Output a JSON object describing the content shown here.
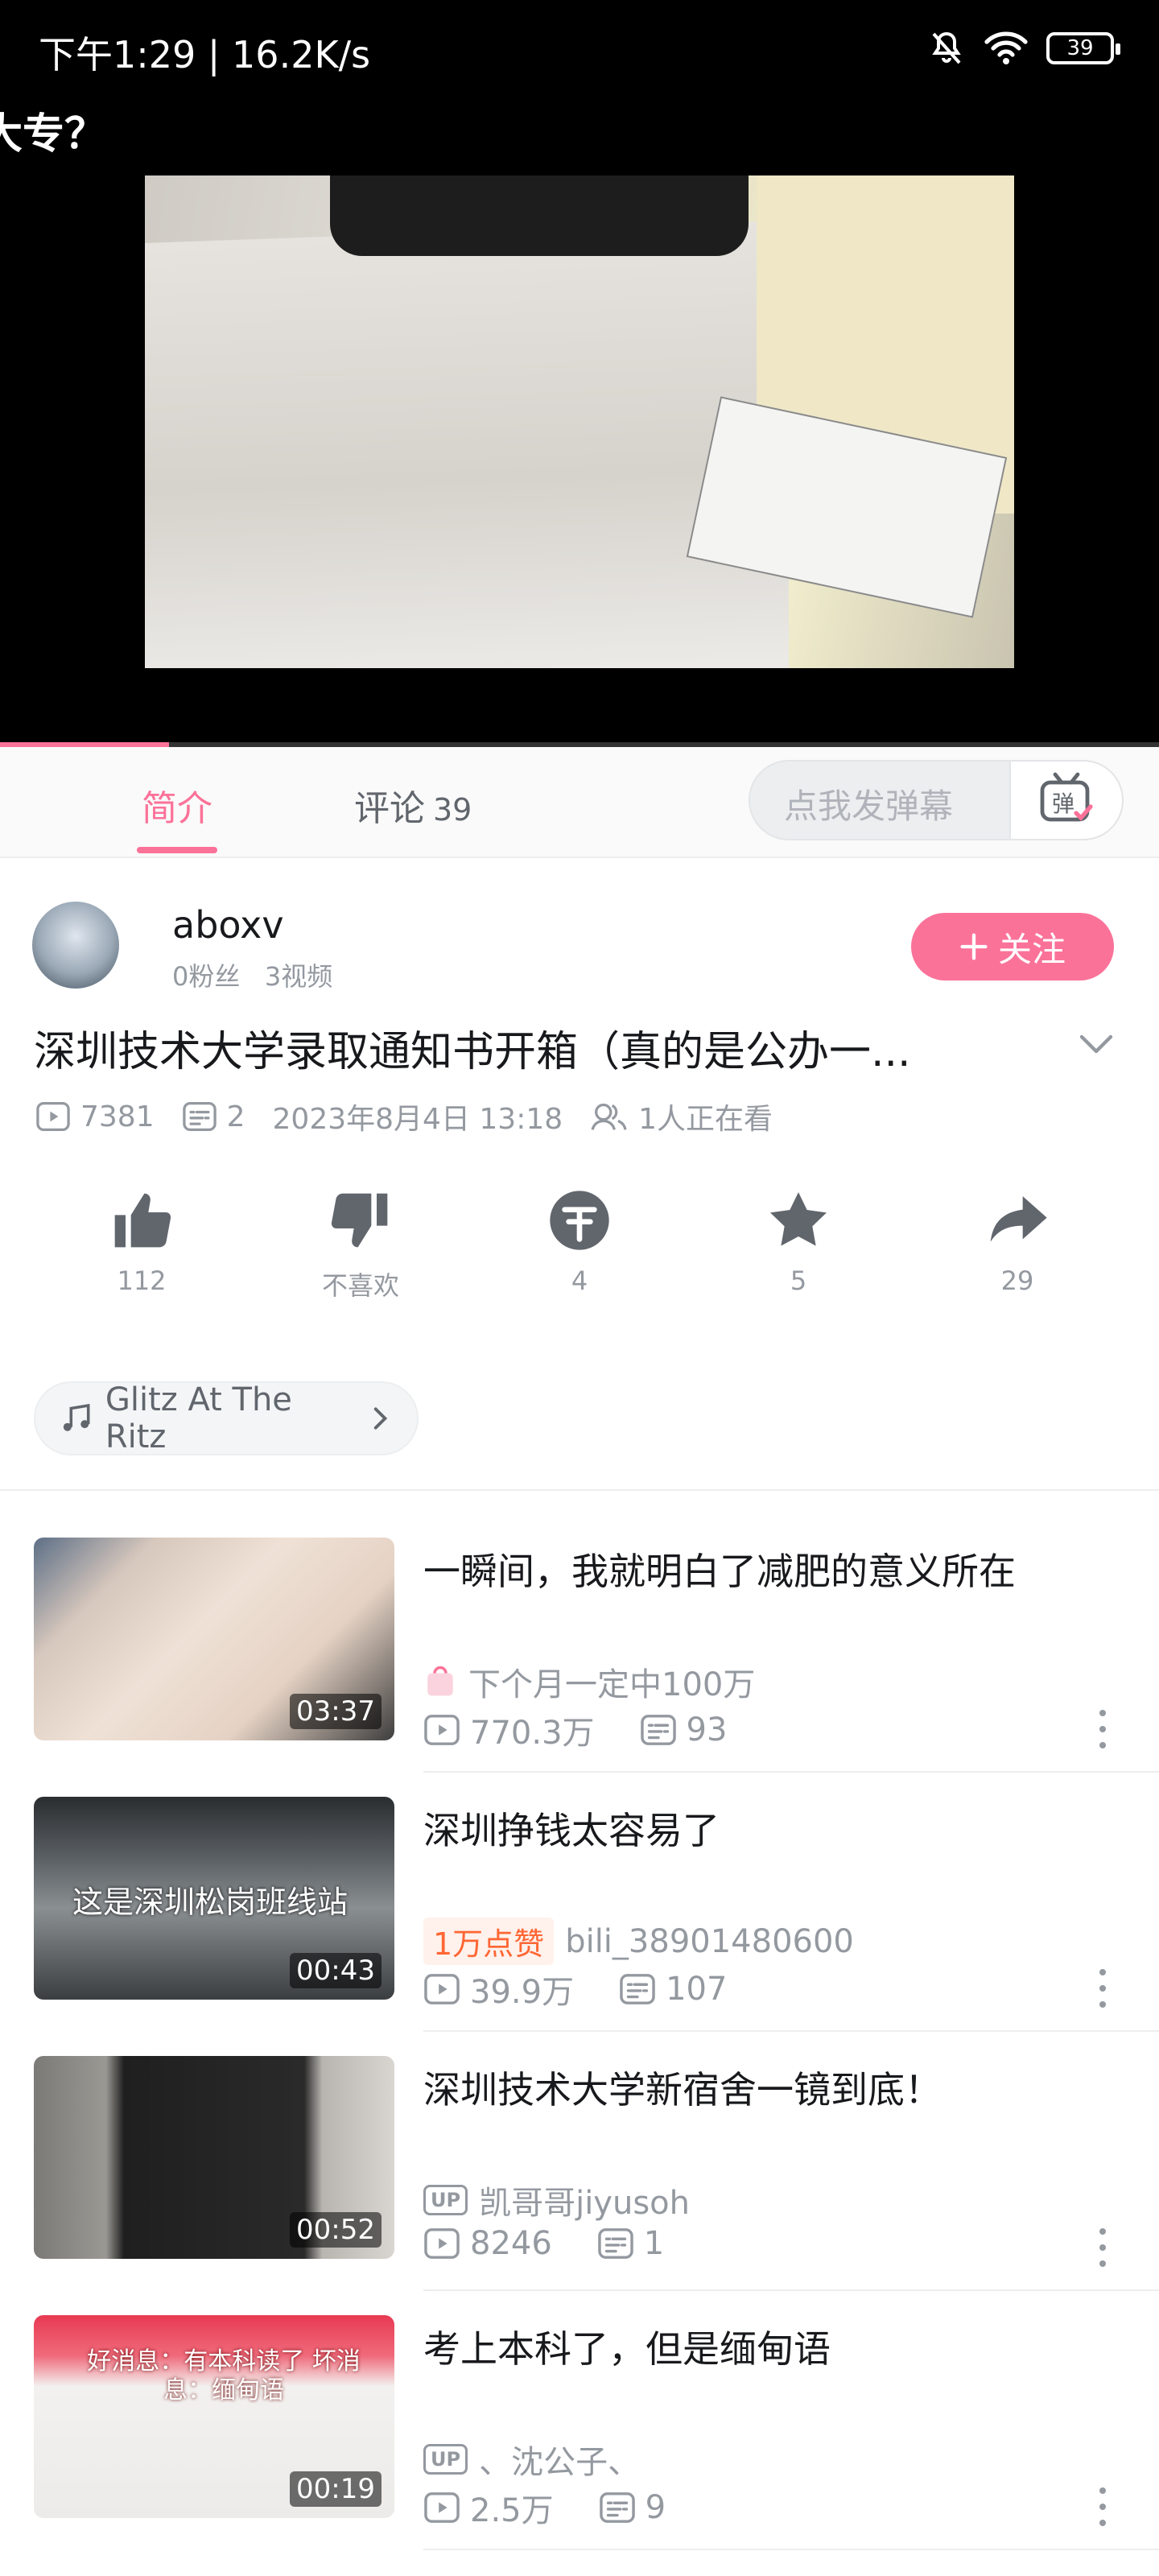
{
  "status_bar": {
    "time": "下午1:29 | 16.2K/s",
    "battery": "39"
  },
  "player": {
    "title_fragment": "大专？",
    "progress_percent": 14.6
  },
  "tabs": {
    "intro": {
      "label": "简介"
    },
    "comments": {
      "label": "评论",
      "count": "39"
    },
    "danmaku_placeholder": "点我发弹幕",
    "danmaku_toggle": "弹"
  },
  "uploader": {
    "name": "aboxv",
    "stats": "0粉丝   3视频",
    "follow_label": "关注"
  },
  "video": {
    "title": "深圳技术大学录取通知书开箱（真的是公办一...",
    "views": "7381",
    "danmaku": "2",
    "date": "2023年8月4日 13:18",
    "watching": "1人正在看"
  },
  "actions": {
    "like": "112",
    "dislike": "不喜欢",
    "coin": "4",
    "favorite": "5",
    "share": "29"
  },
  "music": {
    "label": "Glitz At The Ritz"
  },
  "recommendations": [
    {
      "title": "一瞬间，我就明白了减肥的意义所在",
      "owner": "下个月一定中100万",
      "owner_badge": "",
      "views": "770.3万",
      "comments": "93",
      "duration": "03:37",
      "overlay_text": ""
    },
    {
      "title": "深圳挣钱太容易了",
      "owner": "bili_38901480600",
      "owner_badge": "1万点赞",
      "views": "39.9万",
      "comments": "107",
      "duration": "00:43",
      "overlay_text": "这是深圳松岗班线站"
    },
    {
      "title": "深圳技术大学新宿舍一镜到底！",
      "owner": "凯哥哥jiyusoh",
      "owner_badge": "UP",
      "views": "8246",
      "comments": "1",
      "duration": "00:52",
      "overlay_text": ""
    },
    {
      "title": "考上本科了，但是缅甸语",
      "owner": "、沈公子、",
      "owner_badge": "UP",
      "views": "2.5万",
      "comments": "9",
      "duration": "00:19",
      "overlay_text": "好消息：有本科读了 坏消息：缅甸语"
    }
  ],
  "colors": {
    "accent": "#fb7299",
    "text": "#18191c",
    "muted": "#9499a0"
  }
}
